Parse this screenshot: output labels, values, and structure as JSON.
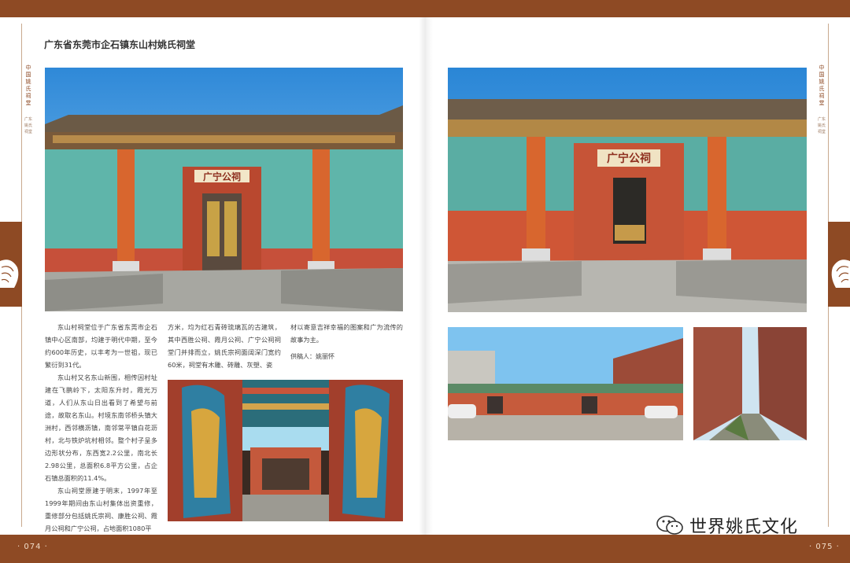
{
  "article_title": "广东省东莞市企石镇东山村姚氏祠堂",
  "side_title": "中国姚氏祠堂",
  "side_subtitle": "广东姚氏祠堂",
  "page_left": "· 074 ·",
  "page_right": "· 075 ·",
  "hall_plaque": "广宁公祠",
  "paragraphs_col1": [
    "东山村祠堂位于广东省东莞市企石镇中心区南部，均建于明代中期，至今约600年历史，以丰考为一世祖，现已繁衍到31代。",
    "东山村又名东山新围，相传因村址建在飞鹏岭下，太阳东升时，霞光万道，人们从东山日出看到了希望与前途，故取名东山。村境东南邻桥头镇大洲村，西邻横沥镇，南邻常平镇白花沥村，北与铁炉坑村相邻。整个村子呈多边形状分布，东西宽2.2公里，南北长2.98公里，总面积6.8平方公里，占企石镇总面积的11.4%。",
    "东山祠堂原建于明末，1997年至1999年期间由东山村集体出资重修，重修部分包括姚氏宗祠、康胜公祠、霞月公祠和广宁公祠，占地面积1080平"
  ],
  "paragraphs_col2": [
    "方米，均为红石青砖琉璃瓦的古建筑，其中西胜公祠、霞月公祠、广宁公祠祠堂门并排而立，姚氏宗祠面阔深门宽约60米，祠堂有木雕、砖雕、灰塑、瓷"
  ],
  "paragraphs_col3": [
    "材以寄意吉祥幸福的图案和广为流传的故事为主。"
  ],
  "editor_label": "供稿人：",
  "editor_name": "姚丽怀",
  "watermark": "世界姚氏文化",
  "colors": {
    "band": "#8e4a24",
    "pillar": "#d8662e",
    "wall_teal": "#5bb0a6",
    "sky": "#3f9be0"
  }
}
